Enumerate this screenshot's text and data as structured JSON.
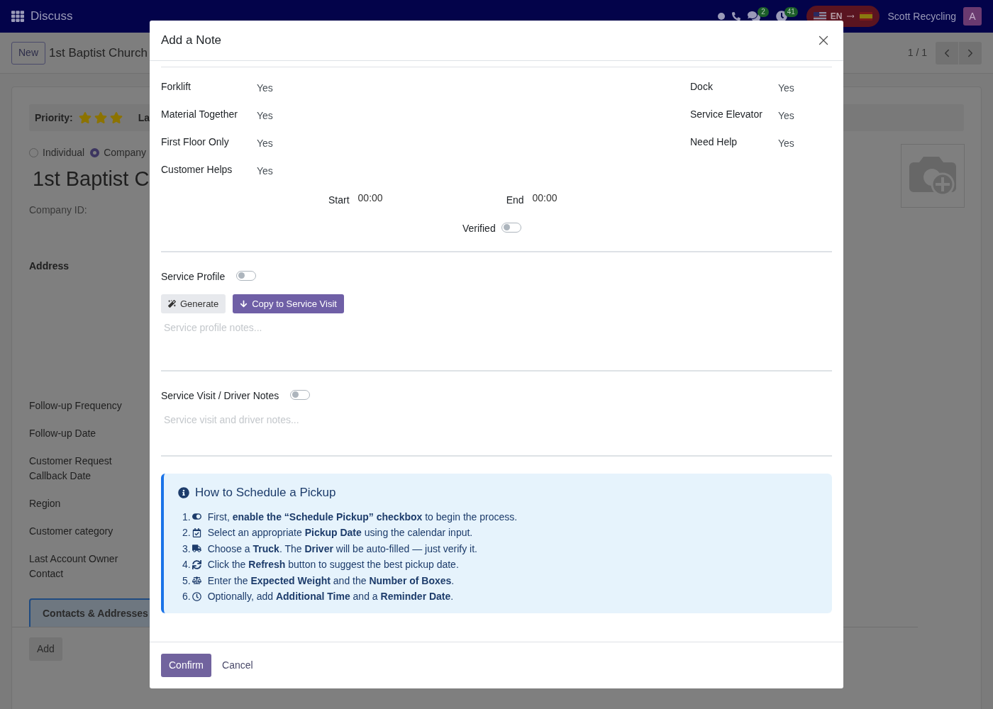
{
  "navbar": {
    "app": "Discuss",
    "chat_badge": "2",
    "activity_badge": "41",
    "language": "EN",
    "company": "Scott Recycling",
    "avatar": "A"
  },
  "control_panel": {
    "new_button": "New",
    "breadcrumb": "1st Baptist Church",
    "pager": "1 / 1"
  },
  "form": {
    "priority_label": "Priority:",
    "stars": 3,
    "next_label": "La",
    "company_type": [
      {
        "label": "Individual",
        "selected": false
      },
      {
        "label": "Company",
        "selected": true
      }
    ],
    "name": "1st Baptist C",
    "company_id_label": "Company ID:",
    "address_label": "Address",
    "fields": [
      "Follow-up Frequency",
      "Follow-up Date",
      "Customer Request Callback Date",
      "Region",
      "Customer category",
      "Last Account Owner Contact"
    ],
    "tab": {
      "label": "Contacts & Addresses",
      "selected": true
    },
    "add_button": "Add"
  },
  "dialog": {
    "title": "Add a Note",
    "profile_left": [
      {
        "label": "Forklift",
        "value": "Yes"
      },
      {
        "label": "Material Together",
        "value": "Yes"
      },
      {
        "label": "First Floor Only",
        "value": "Yes"
      },
      {
        "label": "Customer Helps",
        "value": "Yes"
      }
    ],
    "profile_right": [
      {
        "label": "Dock",
        "value": "Yes"
      },
      {
        "label": "Service Elevator",
        "value": "Yes"
      },
      {
        "label": "Need Help",
        "value": "Yes"
      }
    ],
    "start": {
      "label": "Start",
      "value": "00:00"
    },
    "end": {
      "label": "End",
      "value": "00:00"
    },
    "verified": {
      "label": "Verified",
      "on": false
    },
    "service_profile": {
      "label": "Service Profile",
      "on": false,
      "buttons": [
        {
          "kind": "plain",
          "label": "Generate"
        },
        {
          "kind": "primary",
          "label": "Copy to Service Visit"
        }
      ],
      "placeholder": "Service profile notes..."
    },
    "service_visit": {
      "label": "Service Visit / Driver Notes",
      "on": false,
      "placeholder": "Service visit and driver notes..."
    },
    "help": {
      "title": "How to Schedule a Pickup",
      "steps": [
        {
          "number": "1.",
          "text": "First, **enable the “Schedule Pickup” checkbox** to begin the process."
        },
        {
          "number": "2.",
          "text": "Select an appropriate **Pickup Date** using the calendar input."
        },
        {
          "number": "3.",
          "text": "Choose a **Truck**. The **Driver** will be auto-filled — just verify it."
        },
        {
          "number": "4.",
          "text": "Click the **Refresh** button to suggest the best pickup date."
        },
        {
          "number": "5.",
          "text": "Enter the **Expected Weight** and the **Number of Boxes**."
        },
        {
          "number": "6.",
          "text": "Optionally, add **Additional Time** and a **Reminder Date**."
        }
      ]
    },
    "confirm_button": "Confirm",
    "cancel_button": "Cancel"
  }
}
